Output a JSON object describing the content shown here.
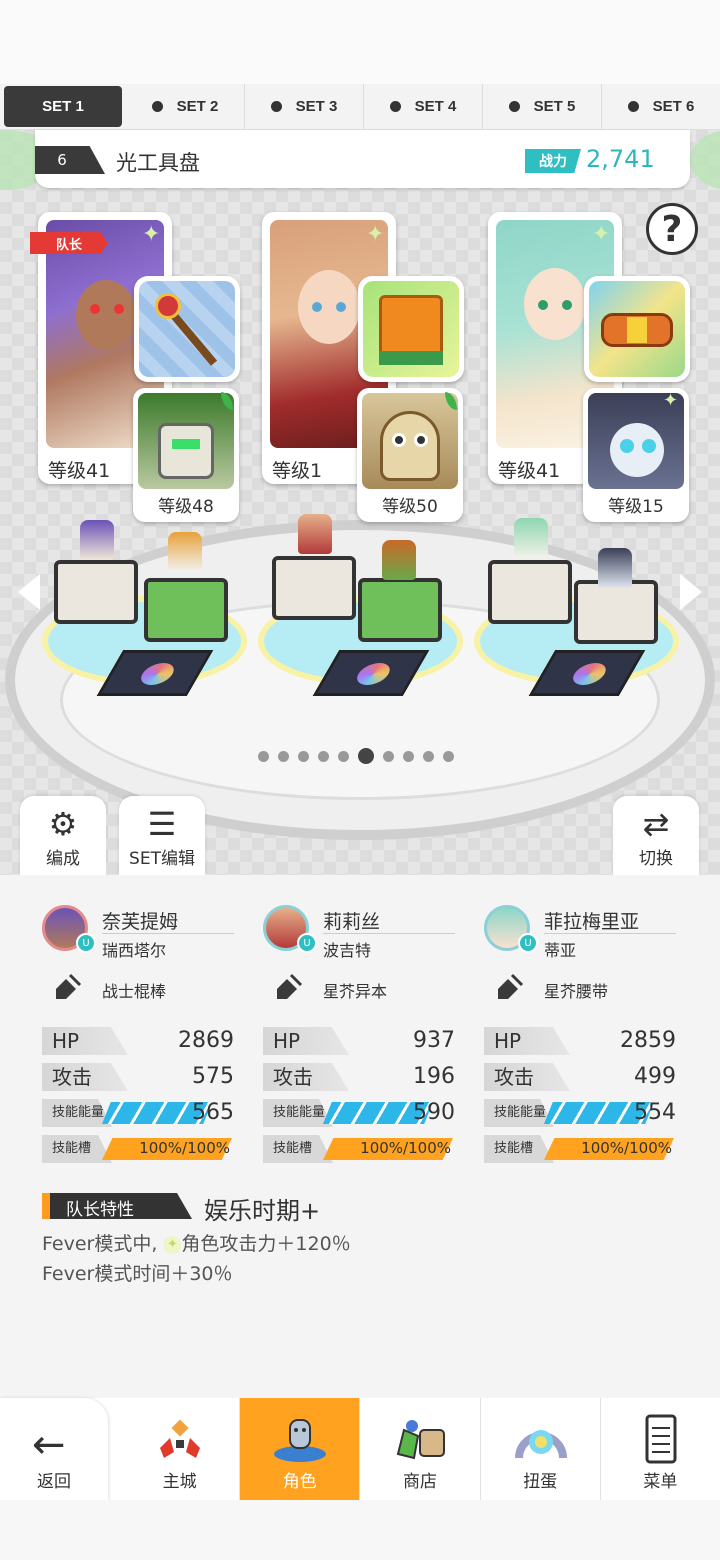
{
  "set_tabs": [
    {
      "label": "SET 1",
      "active": true
    },
    {
      "label": "SET 2",
      "active": false
    },
    {
      "label": "SET 3",
      "active": false
    },
    {
      "label": "SET 4",
      "active": false
    },
    {
      "label": "SET 5",
      "active": false
    },
    {
      "label": "SET 6",
      "active": false
    }
  ],
  "team": {
    "number": "6",
    "name": "光工具盘",
    "power_label": "战力",
    "power_value": "2,741"
  },
  "help_symbol": "?",
  "captain_badge": "队长",
  "characters": [
    {
      "level": "等级41",
      "pet_level": "等级48",
      "name": "奈芙提姆",
      "sub": "瑞西塔尔",
      "weapon": "战士棍棒",
      "hp": "2869",
      "atk": "575",
      "skill_energy": "565",
      "skill_slot": "100%/100%"
    },
    {
      "level": "等级1",
      "pet_level": "等级50",
      "name": "莉莉丝",
      "sub": "波吉特",
      "weapon": "星芥异本",
      "hp": "937",
      "atk": "196",
      "skill_energy": "590",
      "skill_slot": "100%/100%"
    },
    {
      "level": "等级41",
      "pet_level": "等级15",
      "name": "菲拉梅里亚",
      "sub": "蒂亚",
      "weapon": "星芥腰带",
      "hp": "2859",
      "atk": "499",
      "skill_energy": "554",
      "skill_slot": "100%/100%"
    }
  ],
  "stat_labels": {
    "hp": "HP",
    "atk": "攻击",
    "skill_energy": "技能能量",
    "skill_slot": "技能槽"
  },
  "pager": {
    "count": 10,
    "active": 5
  },
  "side_buttons": {
    "formation": "编成",
    "set_edit": "SET编辑",
    "switch": "切换"
  },
  "leader_skill": {
    "label": "队长特性",
    "name": "娱乐时期+",
    "line1_prefix": "Fever模式中,",
    "line1_suffix": "角色攻击力＋120％",
    "line2": "Fever模式时间＋30％"
  },
  "nav": {
    "back": "返回",
    "items": [
      {
        "label": "主城",
        "icon": "castle-icon",
        "active": false
      },
      {
        "label": "角色",
        "icon": "character-icon",
        "active": true
      },
      {
        "label": "商店",
        "icon": "shop-icon",
        "active": false
      },
      {
        "label": "扭蛋",
        "icon": "gacha-icon",
        "active": false
      },
      {
        "label": "菜单",
        "icon": "menu-icon",
        "active": false
      }
    ]
  },
  "colors": {
    "accent": "#ffa21f",
    "power": "#2fbfc3",
    "captain": "#e53935",
    "energy_bar": "#2db6e8"
  }
}
